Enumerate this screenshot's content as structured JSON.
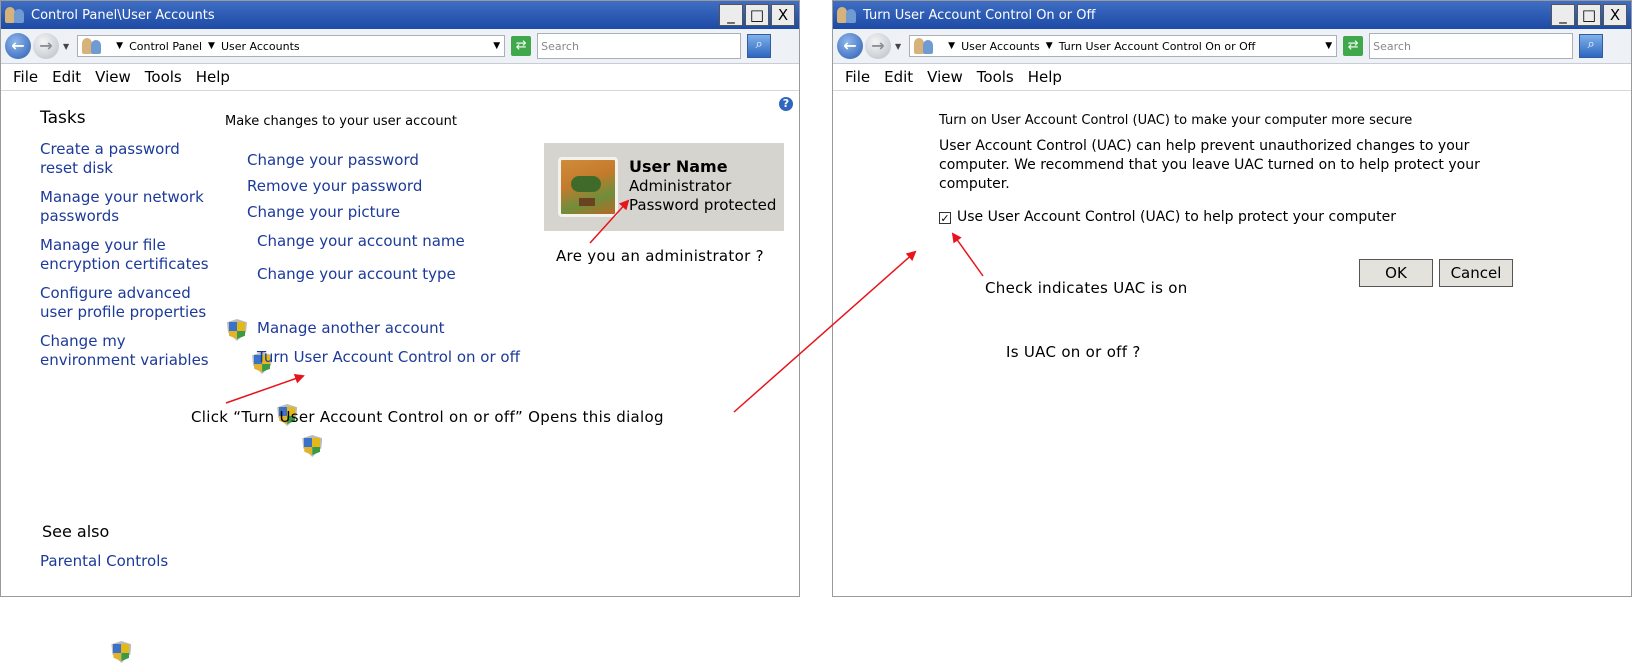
{
  "left_window": {
    "title": "Control Panel\\User Accounts",
    "buttons": {
      "minimize": "_",
      "maximize": "□",
      "close": "X"
    },
    "breadcrumb": [
      "Control Panel",
      "User Accounts"
    ],
    "search_placeholder": "Search",
    "menu": [
      "File",
      "Edit",
      "View",
      "Tools",
      "Help"
    ],
    "tasks_heading": "Tasks",
    "tasks": [
      [
        "Create a password",
        "reset disk"
      ],
      [
        "Manage your network",
        "passwords"
      ],
      [
        "Manage your file",
        "encryption certificates"
      ],
      [
        "Configure advanced",
        "user profile properties"
      ],
      [
        "Change my",
        "environment variables"
      ]
    ],
    "main_heading": "Make changes to your user account",
    "links": {
      "change_password": "Change your password",
      "remove_password": "Remove your password",
      "change_picture": "Change your picture",
      "change_name": "Change your account name",
      "change_type": "Change your account type",
      "manage_another": "Manage another account",
      "uac_toggle": "Turn User Account Control on or off"
    },
    "user": {
      "name": "User Name",
      "role": "Administrator",
      "status": "Password protected"
    },
    "see_also_heading": "See also",
    "see_also": [
      "Parental Controls"
    ]
  },
  "right_window": {
    "title": "Turn User Account Control On or Off",
    "buttons": {
      "minimize": "_",
      "maximize": "□",
      "close": "X"
    },
    "breadcrumb": [
      "User Accounts",
      "Turn User Account Control On or Off"
    ],
    "search_placeholder": "Search",
    "menu": [
      "File",
      "Edit",
      "View",
      "Tools",
      "Help"
    ],
    "heading": "Turn on User Account Control (UAC) to make your computer more secure",
    "description": [
      "User Account Control (UAC) can help prevent unauthorized changes to your",
      "computer.  We recommend that you leave UAC turned on to help protect your",
      "computer."
    ],
    "checkbox_label": "Use User Account Control (UAC) to help protect your computer",
    "checkbox_checked": true,
    "ok_label": "OK",
    "cancel_label": "Cancel"
  },
  "annotations": {
    "admin_question": "Are you an administrator ?",
    "click_instruction": "Click “Turn User Account Control on or off” Opens this dialog",
    "check_note": "Check indicates UAC is on",
    "uac_question": "Is UAC on or off ?"
  },
  "colors": {
    "link": "#1c3a9a",
    "titlebar": "#1d4aa5",
    "arrow": "#e8141c"
  }
}
